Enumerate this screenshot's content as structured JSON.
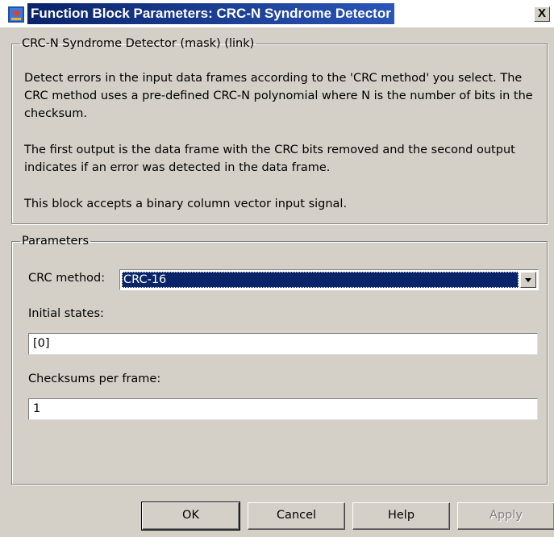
{
  "window": {
    "title": "Function Block Parameters: CRC-N Syndrome Detector",
    "close_label": "X"
  },
  "description": {
    "legend": "CRC-N Syndrome Detector (mask) (link)",
    "paragraphs": [
      "Detect errors in the input data frames according to the 'CRC method' you select. The CRC method uses a pre-defined CRC-N polynomial where N is the number of bits in the checksum.",
      "The first output is the data frame with the CRC bits removed and the second output indicates if an error was detected in the data frame.",
      "This block accepts a binary column vector input signal."
    ]
  },
  "parameters": {
    "legend": "Parameters",
    "crc_method_label": "CRC method:",
    "crc_method_value": "CRC-16",
    "initial_states_label": "Initial states:",
    "initial_states_value": "[0]",
    "checksums_label": "Checksums per frame:",
    "checksums_value": "1"
  },
  "buttons": {
    "ok": "OK",
    "cancel": "Cancel",
    "help": "Help",
    "apply": "Apply"
  }
}
